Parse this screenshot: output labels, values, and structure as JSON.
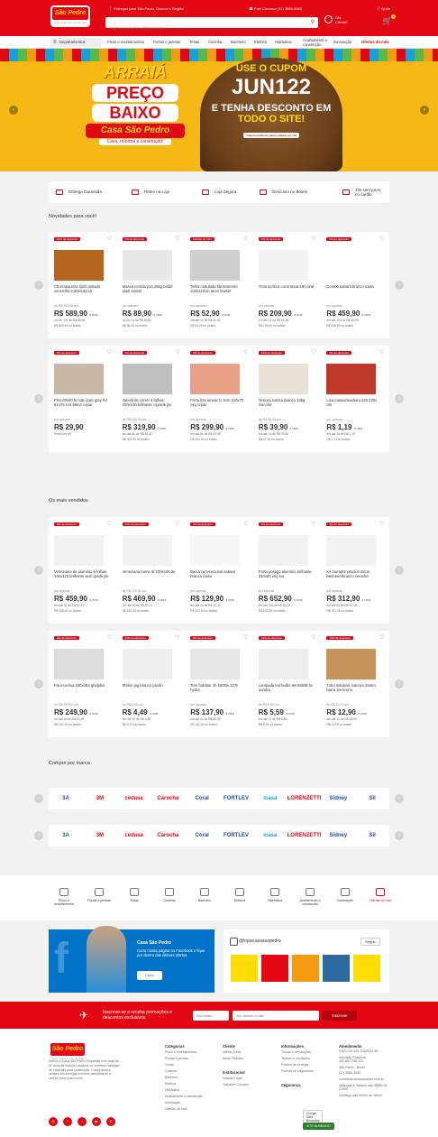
{
  "header": {
    "logo_text": "São Pedro",
    "logo_brand": "Casa",
    "logo_tagline": "Casa, reforma e construção",
    "delivery": "Entregas para São Paulo, Osasco e Região",
    "phone": "Fale Conosco (11) 3686-4080",
    "help": "Ajuda",
    "search_placeholder": "Digite aqui produto categoria marca",
    "account_greeting": "Olá,",
    "account_label": "Cliente!",
    "cart_count": "0"
  },
  "nav": {
    "departments": "Departamentos",
    "items": [
      "Pisos e revestimentos",
      "Portas e janelas",
      "Tintas",
      "Cozinha",
      "Banheiro",
      "Elétrica",
      "Hidráulica",
      "Acabamento e construção",
      "Iluminação",
      "Ofertas do mês"
    ]
  },
  "banner": {
    "l1": "ARRAIÁ",
    "l2": "PREÇO",
    "l3": "BAIXO",
    "brand": "Casa São Pedro",
    "tagline": "Casa, reforma e construção!",
    "use": "USE O CUPOM",
    "code": "JUN122",
    "desc1": "E TENHA DESCONTO EM",
    "desc2": "TODO O SITE!",
    "fine": "*cupom exclusivo para compras no site"
  },
  "benefits": [
    "Entrega Garantida",
    "Retire na Loja",
    "Loja Segura",
    "Desconto no Boleto",
    "10x sem juros no cartão"
  ],
  "sections": {
    "novidades": "Novidades para você!",
    "vendidos": "Os mais vendidos",
    "marcas": "Compre por marca"
  },
  "novidades_row1": [
    {
      "badge": "24% de desconto",
      "name": "Churrasqueira tijolo pintado vermelho 2,20x0,63 ck",
      "old": "de R$ 783,90 por",
      "price": "R$ 589,90",
      "unit": "à vista",
      "inst": "ou em 10x de R$ 58,99",
      "bol": "R$ 560,40 no boleto"
    },
    {
      "badge": "0% de desconto",
      "name": "Massa corrida pva 25kg balde plast suvinil",
      "old": "por apenas",
      "price": "R$ 89,90",
      "unit": "à vista",
      "inst": "ou em 1x de R$ 89,90",
      "bol": "R$ 85,40 no boleto"
    },
    {
      "badge": "Ofertas do mês",
      "name": "Telha ondulada fibrocimento 244x110cm 5mm brasilit",
      "old": "por apenas",
      "price": "R$ 52,90",
      "unit": "à vista",
      "inst": "em até 1x de R$ 52,90",
      "bol": "R$ 50,25 no boleto"
    },
    {
      "badge": "0% de desconto",
      "name": "Tinta acrílica coral areia 18l coral",
      "old": "por apenas",
      "price": "R$ 209,90",
      "unit": "à vista",
      "inst": "em até 4x de R$ 52,48",
      "bol": "R$ 199,40 no boleto"
    },
    {
      "badge": "0% de desconto",
      "name": "Combo sabará branco icasa",
      "old": "por apenas",
      "price": "R$ 459,90",
      "unit": "à vista",
      "inst": "em até 10x de R$ 45,99",
      "bol": "R$ 436,90 no boleto"
    }
  ],
  "novidades_row2": [
    {
      "badge": "8% de desconto",
      "name": "Piso 60x60 hd sao joao gray hd 61475 cx2,58m2 cepar",
      "old": "por apenas",
      "price": "R$ 29,90",
      "unit": "",
      "inst": "Preço por m²",
      "bol": ""
    },
    {
      "badge": "0% de desconto",
      "name": "Janela de correr 4 folhas 100x100 brilhante c/grade j5c",
      "old": "de R$ 409,90 por",
      "price": "R$ 319,90",
      "unit": "à vista",
      "inst": "em até 6x de R$ 53,32",
      "bol": "R$ 303,90 no boleto"
    },
    {
      "badge": "0% de desconto",
      "name": "Porta lisa amesc lc 9cm 210x70 esq cripto",
      "old": "por apenas",
      "price": "R$ 299,90",
      "unit": "à vista",
      "inst": "em até 6x de R$ 50,98",
      "bol": "R$ 284,90 no boleto"
    },
    {
      "badge": "24% de desconto",
      "name": "Textura rustica branco 23kg inacolor",
      "old": "de R$ 52,90 por",
      "price": "R$ 39,90",
      "unit": "à vista",
      "inst": "em até 1x de R$ 39,90",
      "bol": "R$ 37,90 no boleto"
    },
    {
      "badge": "0% de desconto",
      "name": "Lixa massa/madeira 120 230x 3m",
      "old": "por apenas",
      "price": "R$ 1,19",
      "unit": "à vista",
      "inst": "em até 1x de R$ 1,19",
      "bol": "R$ 1,13 no boleto"
    }
  ],
  "vendidos_row1": [
    {
      "badge": "0% de desconto",
      "name": "Veneziana de alumínio 6 folhas 100x120 brilhante sem grade j5c",
      "old": "por apenas",
      "price": "R$ 459,90",
      "unit": "à vista",
      "inst": "em até 9x de R$ 51,10",
      "bol": "R$ 436,90 no boleto"
    },
    {
      "badge": "24% de desconto",
      "name": "Veneziana home 6f 100x100 3e",
      "old": "de R$ 729,90 por",
      "price": "R$ 469,90",
      "unit": "à vista",
      "inst": "em até 9x de R$ 52,21",
      "bol": "R$ 446,40 no boleto"
    },
    {
      "badge": "0% de desconto",
      "name": "Bacia convencional sabará branca icasa",
      "old": "por apenas",
      "price": "R$ 129,90",
      "unit": "à vista",
      "inst": "em até 3x de R$ 43,30",
      "bol": "R$ 123,40 no boleto"
    },
    {
      "badge": "0% de desconto",
      "name": "Porta postigo alumínio brilhante 210x80 esq sur",
      "old": "por apenas",
      "price": "R$ 652,90",
      "unit": "à vista",
      "inst": "em até 10x de R$ 65,29",
      "bol": "R$ 620,25 no boleto"
    },
    {
      "badge": "0% de desconto",
      "name": "Kit tourador proclon 82cm banheiro/branco ceroche",
      "old": "por apenas",
      "price": "R$ 312,90",
      "unit": "à vista",
      "inst": "em até 6x de R$ 52,15",
      "bol": "R$ 297,25 no boleto"
    }
  ],
  "vendidos_row2": [
    {
      "badge": "0% de desconto",
      "name": "Pia inox lisa 150x053 ghelplus",
      "old": "de R$ 299,90 por",
      "price": "R$ 249,90",
      "unit": "à vista",
      "inst": "em até 6x de R$ 41,65",
      "bol": "R$ 237,40 no boleto"
    },
    {
      "badge": "24% de desconto",
      "name": "Plafon pig branco pavão",
      "old": "de R$ 6,90 por",
      "price": "R$ 4,49",
      "unit": "à vista",
      "inst": "em até 1x de R$ 4,49",
      "bol": "R$ 4,27 no boleto"
    },
    {
      "badge": "0% de desconto",
      "name": "Torn hidratar 4h 5500w 127v hydra",
      "old": "por apenas",
      "price": "R$ 137,90",
      "unit": "à vista",
      "inst": "em até 2x de R$ 68,95",
      "bol": "R$ 131,00 no boleto"
    },
    {
      "badge": "24% de desconto",
      "name": "Lampada led bulbo 9w 6500k bv ourolux",
      "old": "de R$ 6,99 por",
      "price": "R$ 5,59",
      "unit": "à vista",
      "inst": "em até 1x de R$ 5,59",
      "bol": "R$ 5,31 no boleto"
    },
    {
      "badge": "18% de desconto",
      "name": "Tubo soldavel marrom 25mm barra 3m krona",
      "old": "de R$ 15,70 por",
      "price": "R$ 12,90",
      "unit": "à vista",
      "inst": "em até 1x de R$ 12,90",
      "bol": "R$ 12,25 no boleto"
    }
  ],
  "brands": [
    "3A",
    "3M",
    "cedasa",
    "Carocha",
    "Coral",
    "FORTLEV",
    "icasa",
    "LORENZETTI",
    "Sidney",
    "Sil"
  ],
  "brand_colors": [
    "#1b4fa0",
    "#e30613",
    "#e30613",
    "#e30613",
    "#1b4fa0",
    "#1b4fa0",
    "#18a1d8",
    "#e30613",
    "#1b4fa0",
    "#1b4fa0"
  ],
  "categories": [
    "Pisos e revestimentos",
    "Portas e janelas",
    "Tintas",
    "Cozinha",
    "Banheiro",
    "Elétrica",
    "Hidráulica",
    "Acabamento e construção",
    "Iluminação",
    "Ofertas do mês"
  ],
  "facebook": {
    "title": "Casa São Pedro",
    "text": "Curta nossa página no Facebook e fique por dentro das últimas ofertas.",
    "button": "Curtir"
  },
  "instagram": {
    "handle": "@lojascasasaopedro",
    "follow": "Seguir"
  },
  "newsletter": {
    "text": "Inscreve-se e receba promoções e descontos exclusivos.",
    "name_ph": "Seu nome",
    "email_ph": "Seu melhor e-mail",
    "button": "Inscrever"
  },
  "footer": {
    "about": "Somos a Casa São Pedro Empresas com mais de 50 anos de tradição atuando no comércio varejista de materiais para construção. Compromisso sempre em entregar a melhor atendimento e melhor preço para você!",
    "col1_title": "Categorias",
    "col1": [
      "Pisos e revestimentos",
      "Portas e janelas",
      "Tintas",
      "Cozinha",
      "Banheiro",
      "Elétrica",
      "Hidráulica",
      "Acabamento e construção",
      "Iluminação",
      "Ofertas do mês"
    ],
    "col2_title": "Cliente",
    "col2": [
      "Minha Conta",
      "Meus Pedidos"
    ],
    "col2b_title": "Institucional",
    "col2b": [
      "Nossas Lojas",
      "Trabalhe Conosco"
    ],
    "col3_title": "Informações",
    "col3": [
      "Trocas e devoluções",
      "Termos e condições",
      "Política de entrega",
      "Formas de pagamento"
    ],
    "col3b_title": "Segurança",
    "col4_title": "Atendimento",
    "col4": [
      "CNPJ: 60.405.720/0001-83",
      "Inscrição Estadual: 492.867.788.115",
      "São Paulo - Brasil",
      "(11) 3686-4080",
      "contato@casasaopedro.com.br",
      "Segunda a Sábado das 08h00 às 21h00",
      "Domingo das 09h00 às 18h00"
    ],
    "seal1": "Google Safe Browsing",
    "seal2": "SITE BLINDADO"
  }
}
